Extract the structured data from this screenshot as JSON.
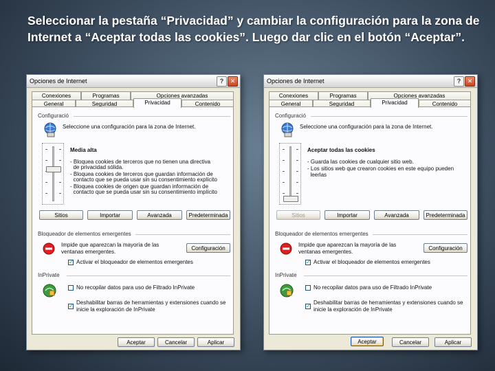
{
  "slide": {
    "title": "Seleccionar la pestaña “Privacidad” y cambiar la configuración para la zona de Internet a “Aceptar todas las cookies”. Luego dar clic en el botón “Aceptar”."
  },
  "dialogs": [
    {
      "title": "Opciones de Internet",
      "tabs_row1": [
        "Conexiones",
        "Programas",
        "Opciones avanzadas"
      ],
      "tabs_row2": [
        "General",
        "Seguridad",
        "Privacidad",
        "Contenido"
      ],
      "active_tab": "Privacidad",
      "config_group": "Configuració",
      "config_desc": "Seleccione una configuración para la zona de Internet.",
      "level_title": "Media alta",
      "level_lines": [
        "- Bloquea cookies de terceros que no tienen una directiva",
        "  de privacidad sólida.",
        "- Bloquea cookies de terceros que guardan información de",
        "  contacto que se pueda usar sin su consentimiento explícito",
        "- Bloquea cookies de origen que guardan información de",
        "  contacto que se pueda usar sin su consentimiento implícito"
      ],
      "slider_level": 0.6,
      "buttons_row": [
        "Sitios",
        "Importar",
        "Avanzada",
        "Predeterminada"
      ],
      "buttons_row_disabled": [
        false,
        false,
        false,
        false
      ],
      "popup_group": "Bloqueador de elementos emergentes",
      "popup_desc": "Impide que aparezcan la mayoría de las ventanas emergentes.",
      "popup_button": "Configuración",
      "popup_checkbox": "Activar el bloqueador de elementos emergentes",
      "inprivate_group": "InPrivate",
      "inprivate_check1": "No recopilar datos para uso de Filtrado InPrivate",
      "inprivate_check2": "Deshabilitar barras de herramientas y extensiones cuando se inicie la exploración de InPrivate",
      "footer_buttons": [
        "Aceptar",
        "Cancelar",
        "Aplicar"
      ]
    },
    {
      "title": "Opciones de Internet",
      "tabs_row1": [
        "Conexiones",
        "Programas",
        "Opciones avanzadas"
      ],
      "tabs_row2": [
        "General",
        "Seguridad",
        "Privacidad",
        "Contenido"
      ],
      "active_tab": "Privacidad",
      "config_group": "Configuració",
      "config_desc": "Seleccione una configuración para la zona de Internet.",
      "level_title": "Aceptar todas las cookies",
      "level_lines": [
        "- Guarda las cookies de cualquier sitio web.",
        "- Los sitios web que crearon cookies en este equipo pueden",
        "  leerlas"
      ],
      "slider_level": 0.0,
      "buttons_row": [
        "Sitios",
        "Importar",
        "Avanzada",
        "Predeterminada"
      ],
      "buttons_row_disabled": [
        true,
        false,
        false,
        false
      ],
      "popup_group": "Bloqueador de elementos emergentes",
      "popup_desc": "Impide que aparezcan la mayoría de las ventanas emergentes.",
      "popup_button": "Configuración",
      "popup_checkbox": "Activar el bloqueador de elementos emergentes",
      "inprivate_group": "InPrivate",
      "inprivate_check1": "No recopilar datos para uso de Filtrado InPrivate",
      "inprivate_check2": "Deshabilitar barras de herramientas y extensiones cuando se inicie la exploración de InPrivate",
      "footer_buttons": [
        "Aceptar",
        "Cancelar",
        "Aplicar"
      ]
    }
  ]
}
